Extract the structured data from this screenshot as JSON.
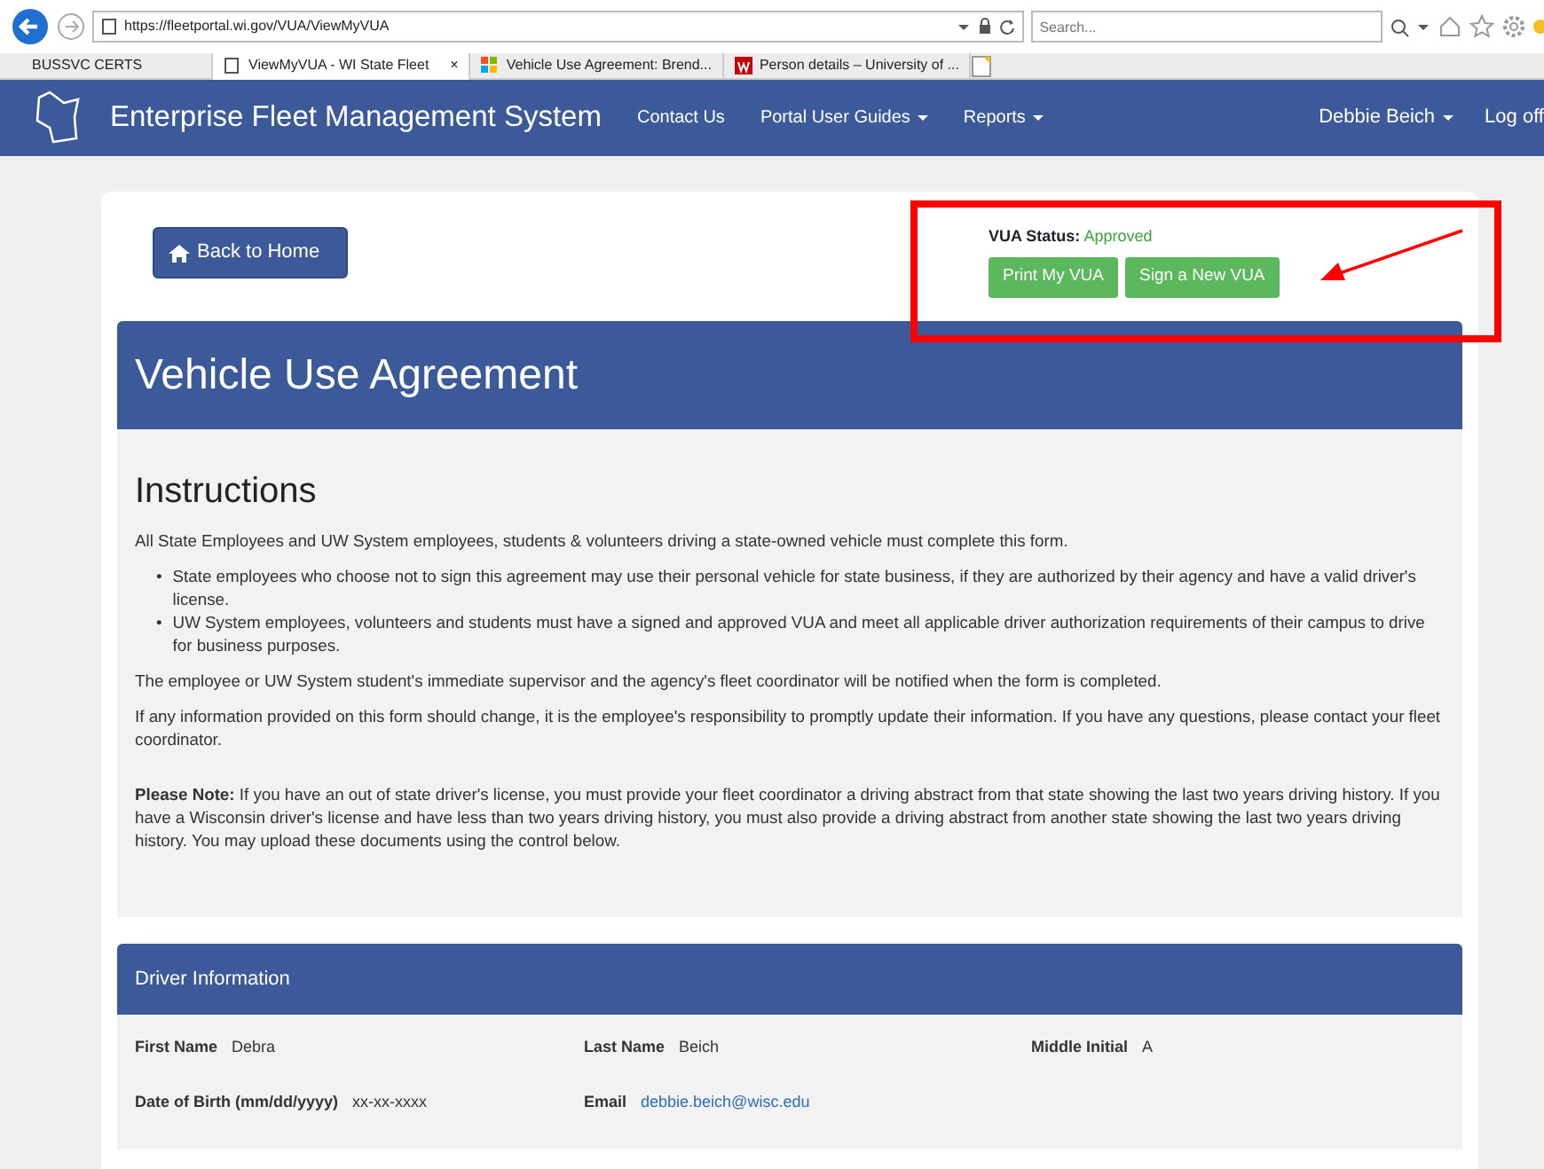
{
  "browser": {
    "url": "https://fleetportal.wi.gov/VUA/ViewMyVUA",
    "search_placeholder": "Search...",
    "favorites": [
      "BUSSVC CERTS"
    ],
    "tabs": [
      {
        "title": "ViewMyVUA - WI State Fleet",
        "selected": true,
        "close": "×",
        "kind": "page"
      },
      {
        "title": "Vehicle Use Agreement: Brend...",
        "selected": false,
        "kind": "tiles"
      },
      {
        "title": "Person details – University of ...",
        "selected": false,
        "kind": "letter"
      }
    ]
  },
  "navbar": {
    "brand": "Enterprise Fleet Management System",
    "links": [
      {
        "label": "Contact Us",
        "dropdown": false
      },
      {
        "label": "Portal User Guides",
        "dropdown": true
      },
      {
        "label": "Reports",
        "dropdown": true
      }
    ],
    "user": {
      "label": "Debbie Beich",
      "dropdown": true
    },
    "logout": "Log off"
  },
  "actions": {
    "back_button": "Back to Home",
    "status_label": "VUA Status:",
    "status_value": "Approved",
    "buttons": [
      "Print My VUA",
      "Sign a New VUA"
    ]
  },
  "title": "Vehicle Use Agreement",
  "instructions": {
    "heading": "Instructions",
    "intro": "All State Employees and UW System employees, students & volunteers driving a state-owned vehicle must complete this form.",
    "bullets": [
      {
        "marker": "•",
        "text": "State employees who choose not to sign this agreement may use their personal vehicle for state business, if they are authorized by their agency and have a valid driver's license."
      },
      {
        "marker": "•",
        "text": "UW System employees, volunteers and students must have a signed and approved VUA and meet all applicable driver authorization requirements of their campus to drive for business purposes."
      }
    ],
    "paragraphs": [
      "The employee or UW System student's immediate supervisor and the agency's fleet coordinator will be notified when the form is completed.",
      "If any information provided on this form should change, it is the employee's responsibility to promptly update their information. If you have any questions, please contact your fleet coordinator."
    ],
    "note": "**Please Note:** If you have an out of state driver's license, you must provide your fleet coordinator a driving abstract from that state showing the last two years driving history. If you have a Wisconsin driver's license and have less than two years driving history, you must also provide a driving abstract from another state showing the last two years driving history. You may upload these documents using the control below."
  },
  "driver": {
    "heading": "Driver Information",
    "fields": [
      {
        "label": "First Name",
        "value": "Debra",
        "kind": "text"
      },
      {
        "label": "Last Name",
        "value": "Beich",
        "kind": "text"
      },
      {
        "label": "Middle Initial",
        "value": "A",
        "kind": "text"
      },
      {
        "label": "Date of Birth (mm/dd/yyyy)",
        "value": "xx-xx-xxxx",
        "kind": "text"
      },
      {
        "label": "Email",
        "value": "debbie.beich@wisc.edu",
        "kind": "link"
      }
    ]
  }
}
